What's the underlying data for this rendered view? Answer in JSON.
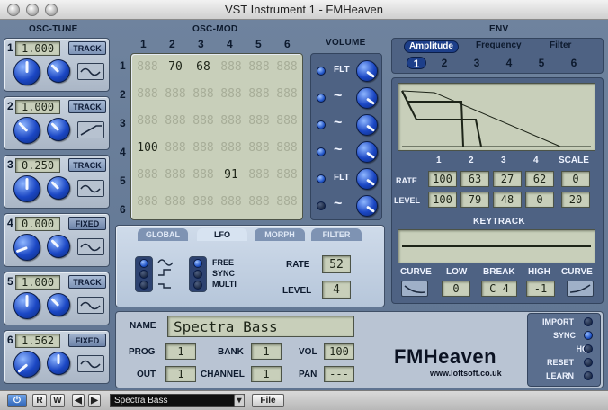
{
  "window": {
    "title": "VST Instrument 1 - FMHeaven"
  },
  "sections": {
    "osc_tune": "OSC-TUNE",
    "osc_mod": "OSC-MOD",
    "volume": "VOLUME",
    "env": "ENV",
    "keytrack": "KEYTRACK"
  },
  "osc_tune": [
    {
      "num": "1",
      "value": "1.000",
      "mode": "TRACK"
    },
    {
      "num": "2",
      "value": "1.000",
      "mode": "TRACK"
    },
    {
      "num": "3",
      "value": "0.250",
      "mode": "TRACK"
    },
    {
      "num": "4",
      "value": "0.000",
      "mode": "FIXED"
    },
    {
      "num": "5",
      "value": "1.000",
      "mode": "TRACK"
    },
    {
      "num": "6",
      "value": "1.562",
      "mode": "FIXED"
    }
  ],
  "osc_mod": {
    "cols": [
      "1",
      "2",
      "3",
      "4",
      "5",
      "6"
    ],
    "rows": [
      "1",
      "2",
      "3",
      "4",
      "5",
      "6"
    ],
    "cells": [
      [
        "",
        "70",
        "68",
        "",
        "",
        ""
      ],
      [
        "",
        "",
        "",
        "",
        "",
        ""
      ],
      [
        "",
        "",
        "",
        "",
        "",
        ""
      ],
      [
        "100",
        "",
        "",
        "",
        "",
        ""
      ],
      [
        "",
        "",
        "",
        "91",
        "",
        ""
      ],
      [
        "",
        "",
        "",
        "",
        "",
        ""
      ]
    ]
  },
  "volume": [
    {
      "wave": "FLT"
    },
    {
      "wave": "~"
    },
    {
      "wave": "~"
    },
    {
      "wave": "~"
    },
    {
      "wave": "FLT"
    },
    {
      "wave": "~"
    }
  ],
  "env": {
    "tabs": [
      "Amplitude",
      "Frequency",
      "Filter"
    ],
    "active_tab": "Amplitude",
    "osc_selector": [
      "1",
      "2",
      "3",
      "4",
      "5",
      "6"
    ],
    "stage_headers": [
      "1",
      "2",
      "3",
      "4",
      "SCALE"
    ],
    "rate_label": "RATE",
    "level_label": "LEVEL",
    "rate": [
      "100",
      "63",
      "27",
      "62",
      "0"
    ],
    "level": [
      "100",
      "79",
      "48",
      "0",
      "20"
    ]
  },
  "keytrack": {
    "labels": [
      "CURVE",
      "LOW",
      "BREAK",
      "HIGH",
      "CURVE"
    ],
    "low": "0",
    "break": "C 4",
    "high": "-1"
  },
  "lfo": {
    "tabs": [
      "GLOBAL",
      "LFO",
      "MORPH",
      "FILTER"
    ],
    "active_tab": "LFO",
    "modes": [
      "FREE",
      "SYNC",
      "MULTI"
    ],
    "rate_label": "RATE",
    "rate": "52",
    "level_label": "LEVEL",
    "level": "4"
  },
  "preset": {
    "name_label": "NAME",
    "name": "Spectra Bass",
    "prog_label": "PROG",
    "prog": "1",
    "bank_label": "BANK",
    "bank": "1",
    "vol_label": "VOL",
    "vol": "100",
    "out_label": "OUT",
    "out": "1",
    "channel_label": "CHANNEL",
    "channel": "1",
    "pan_label": "PAN",
    "pan": "---"
  },
  "right_buttons": [
    "IMPORT",
    "SYNC",
    "HQ",
    "RESET",
    "LEARN"
  ],
  "brand": {
    "name": "FMHeaven",
    "url": "www.loftsoft.co.uk"
  },
  "toolbar": {
    "r": "R",
    "w": "W",
    "preset": "Spectra Bass",
    "file": "File"
  }
}
